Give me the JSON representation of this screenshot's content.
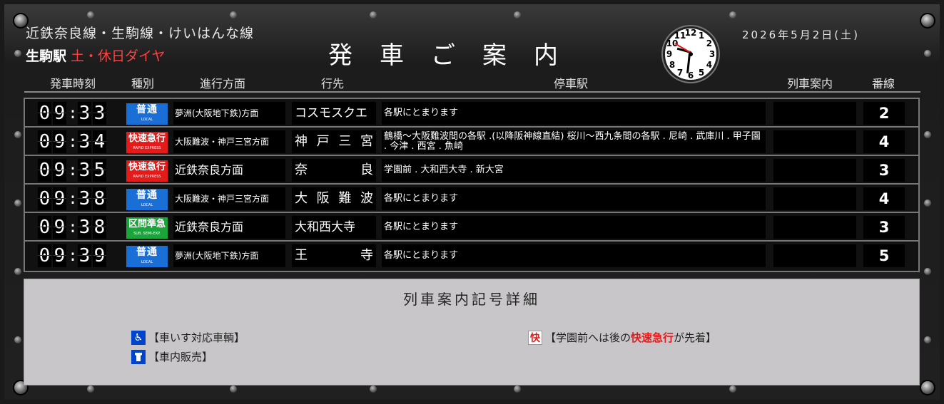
{
  "header": {
    "line_name": "近鉄奈良線・生駒線・けいはんな線",
    "station": "生駒駅",
    "schedule": "土・休日ダイヤ",
    "title": "発車ご案内",
    "date": "2026年5月2日(土)",
    "clock": {
      "hour": 9,
      "minute": 31
    }
  },
  "columns": {
    "time": "発車時刻",
    "type": "種別",
    "direction": "進行方面",
    "destination": "行先",
    "stops": "停車駅",
    "info": "列車案内",
    "track": "番線"
  },
  "rows": [
    {
      "time": "09:33",
      "type": "普通",
      "type_sub": "LOCAL",
      "type_class": "local",
      "direction": "夢洲(大阪地下鉄)方面",
      "destination": "コスモスクエア",
      "stops": "各駅にとまります",
      "info": "",
      "track": "2"
    },
    {
      "time": "09:34",
      "type": "快速急行",
      "type_sub": "RAPID EXPRESS",
      "type_class": "rapid",
      "direction": "大阪難波・神戸三宮方面",
      "destination": "神戸三宮",
      "stops": "鶴橋～大阪難波間の各駅 .(以降阪神線直結) 桜川～西九条間の各駅 . 尼崎 . 武庫川 . 甲子園 . 今津 . 西宮 . 魚崎",
      "info": "",
      "track": "4"
    },
    {
      "time": "09:35",
      "type": "快速急行",
      "type_sub": "RAPID EXPRESS",
      "type_class": "rapid",
      "direction": "近鉄奈良方面",
      "destination": "奈良",
      "stops": "学園前 . 大和西大寺 . 新大宮",
      "info": "",
      "track": "3"
    },
    {
      "time": "09:38",
      "type": "普通",
      "type_sub": "LOCAL",
      "type_class": "local",
      "direction": "大阪難波・神戸三宮方面",
      "destination": "大阪難波",
      "stops": "各駅にとまります",
      "info": "",
      "track": "4"
    },
    {
      "time": "09:38",
      "type": "区間準急",
      "type_sub": "SUB. SEMI-EXP.",
      "type_class": "semi",
      "direction": "近鉄奈良方面",
      "destination": "大和西大寺",
      "stops": "各駅にとまります",
      "info": "",
      "track": "3"
    },
    {
      "time": "09:39",
      "type": "普通",
      "type_sub": "LOCAL",
      "type_class": "local",
      "direction": "夢洲(大阪地下鉄)方面",
      "destination": "王寺",
      "stops": "各駅にとまります",
      "info": "",
      "track": "5"
    }
  ],
  "legend": {
    "title": "列車案内記号詳細",
    "wheelchair": "【車いす対応車輌】",
    "sales": "【車内販売】",
    "fast_icon": "快",
    "fast_pre": "【学園前へは後の",
    "fast_hl": "快速急行",
    "fast_post": "が先着】"
  }
}
